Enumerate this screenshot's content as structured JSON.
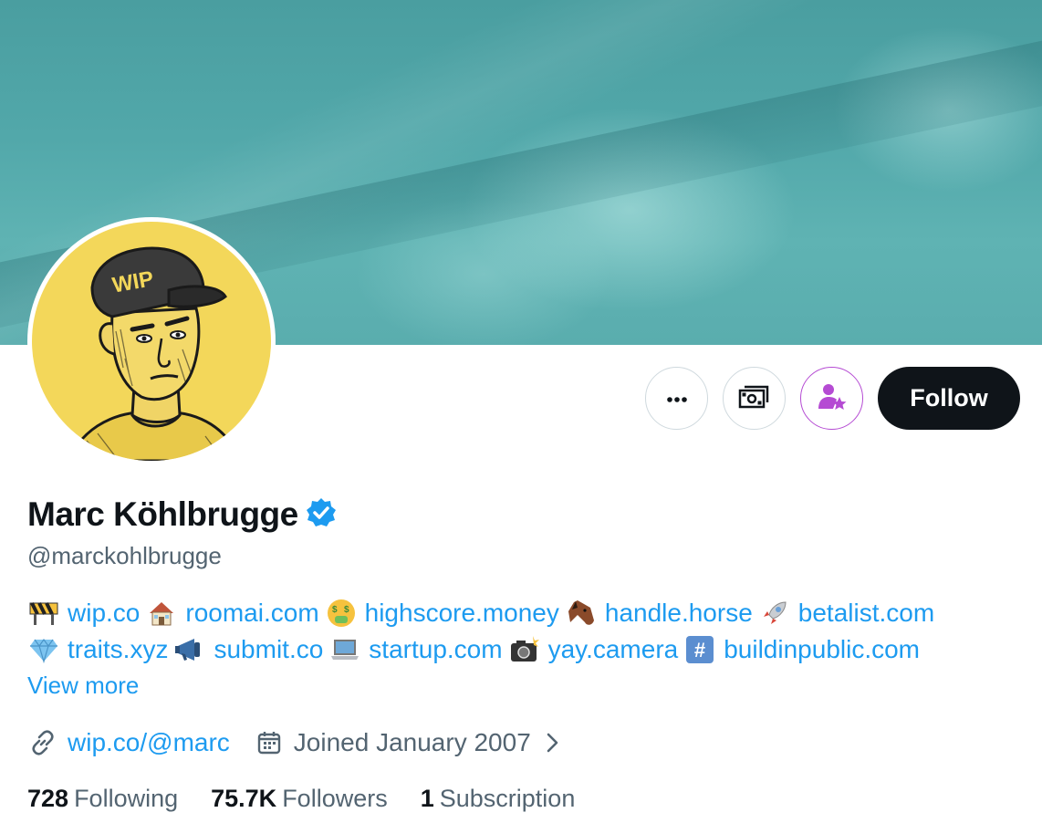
{
  "profile": {
    "name": "Marc Köhlbrugge",
    "handle": "@marckohlbrugge",
    "verified": true,
    "avatar_cap_text": "WIP"
  },
  "actions": {
    "more_icon": "ellipsis-icon",
    "tip_icon": "money-icon",
    "subscribe_icon": "person-star-icon",
    "follow_label": "Follow"
  },
  "bio": {
    "line1": [
      {
        "emoji": "construction-sign-icon",
        "text": "wip.co"
      },
      {
        "emoji": "house-icon",
        "text": "roomai.com"
      },
      {
        "emoji": "money-mouth-face-icon",
        "text": "highscore.money"
      },
      {
        "emoji": "horse-face-icon",
        "text": "handle.horse"
      },
      {
        "emoji": "rocket-icon",
        "text": "betalist.com"
      }
    ],
    "line2": [
      {
        "emoji": "gem-icon",
        "text": "traits.xyz"
      },
      {
        "emoji": "megaphone-icon",
        "text": "submit.co"
      },
      {
        "emoji": "laptop-icon",
        "text": "startup.com"
      },
      {
        "emoji": "camera-flash-icon",
        "text": "yay.camera"
      },
      {
        "emoji": "hash-keycap-icon",
        "text": "buildinpublic.com"
      }
    ],
    "view_more": "View more"
  },
  "meta": {
    "link": "wip.co/@marc",
    "joined": "Joined January 2007"
  },
  "stats": {
    "following_count": "728",
    "following_label": "Following",
    "followers_count": "75.7K",
    "followers_label": "Followers",
    "subscription_count": "1",
    "subscription_label": "Subscription"
  },
  "colors": {
    "accent": "#1d9bf0",
    "secondary_text": "#536471",
    "follow_bg": "#0f1419",
    "subscribe_accent": "#b54bd3",
    "avatar_bg": "#f3d75a",
    "banner": "#5aadae"
  }
}
